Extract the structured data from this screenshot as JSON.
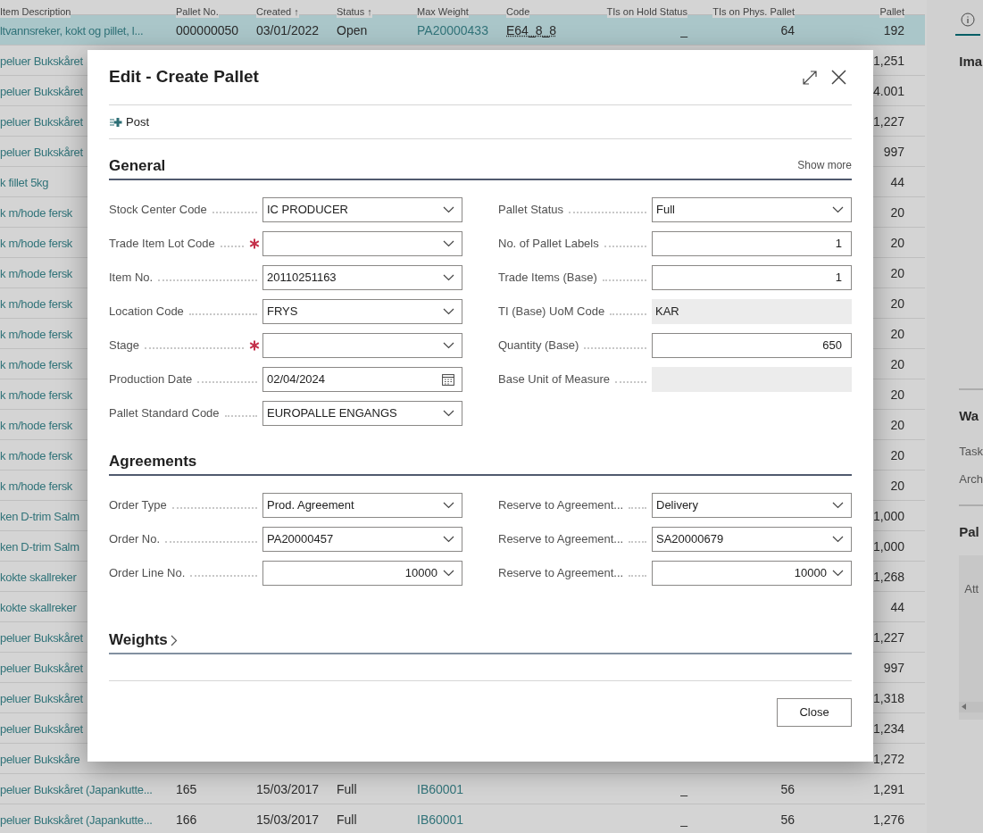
{
  "table": {
    "columns": [
      "Item Description",
      "Pallet No.",
      "Created ↑",
      "Status ↑",
      "Max Weight",
      "Code",
      "TIs on Hold Status",
      "TIs on Phys. Pallet",
      "Pallet"
    ],
    "rows": [
      {
        "selected": true,
        "cells": [
          "ltvannsreker, kokt og pillet, l...",
          "000000050",
          "03/01/2022",
          "Open",
          "PA20000433",
          "E64_8_8",
          "_",
          "64",
          "192"
        ]
      },
      {
        "selected": false,
        "cells": [
          "peluer Bukskåret",
          "1,251"
        ]
      },
      {
        "selected": false,
        "cells": [
          "peluer Bukskåret",
          "4.001"
        ]
      },
      {
        "selected": false,
        "cells": [
          "peluer Bukskåret",
          "1,227"
        ]
      },
      {
        "selected": false,
        "cells": [
          "peluer Bukskåret",
          "997"
        ]
      },
      {
        "selected": false,
        "cells": [
          "k fillet 5kg",
          "44"
        ]
      },
      {
        "selected": false,
        "cells": [
          "k m/hode fersk",
          "20"
        ]
      },
      {
        "selected": false,
        "cells": [
          "k m/hode fersk",
          "20"
        ]
      },
      {
        "selected": false,
        "cells": [
          "k m/hode fersk",
          "20"
        ]
      },
      {
        "selected": false,
        "cells": [
          "k m/hode fersk",
          "20"
        ]
      },
      {
        "selected": false,
        "cells": [
          "k m/hode fersk",
          "20"
        ]
      },
      {
        "selected": false,
        "cells": [
          "k m/hode fersk",
          "20"
        ]
      },
      {
        "selected": false,
        "cells": [
          "k m/hode fersk",
          "20"
        ]
      },
      {
        "selected": false,
        "cells": [
          "k m/hode fersk",
          "20"
        ]
      },
      {
        "selected": false,
        "cells": [
          "k m/hode fersk",
          "20"
        ]
      },
      {
        "selected": false,
        "cells": [
          "k m/hode fersk",
          "20"
        ]
      },
      {
        "selected": false,
        "cells": [
          "ken D-trim Salm",
          "1,000"
        ]
      },
      {
        "selected": false,
        "cells": [
          "ken D-trim Salm",
          "1,000"
        ]
      },
      {
        "selected": false,
        "cells": [
          "kokte skallreker",
          "1,268"
        ]
      },
      {
        "selected": false,
        "cells": [
          "kokte skallreker",
          "44"
        ]
      },
      {
        "selected": false,
        "cells": [
          "peluer Bukskåret",
          "1,227"
        ]
      },
      {
        "selected": false,
        "cells": [
          "peluer Bukskåret",
          "997"
        ]
      },
      {
        "selected": false,
        "cells": [
          "peluer Bukskåret",
          "1,318"
        ]
      },
      {
        "selected": false,
        "cells": [
          "peluer Bukskåret",
          "1,234"
        ]
      },
      {
        "selected": false,
        "cells": [
          "peluer Bukskåre",
          "1,272"
        ]
      },
      {
        "selected": false,
        "cells": [
          "peluer Bukskåret (Japankutte...",
          "165",
          "15/03/2017",
          "Full",
          "IB60001",
          "",
          "_",
          "56",
          "1,291"
        ]
      },
      {
        "selected": false,
        "cells": [
          "peluer Bukskåret (Japankutte...",
          "166",
          "15/03/2017",
          "Full",
          "IB60001",
          "",
          "_",
          "56",
          "1,276"
        ]
      }
    ]
  },
  "factbox": {
    "sections": [
      {
        "title": "Ima"
      },
      {
        "title": "Wa",
        "items": [
          "Task",
          "Arch"
        ]
      },
      {
        "title": "Pal",
        "items": [
          "Att"
        ]
      }
    ]
  },
  "dialog": {
    "title": "Edit - Create Pallet",
    "action": "Post",
    "sections": [
      {
        "title": "General",
        "collapsed": false,
        "show_more": "Show more",
        "left": [
          {
            "label": "Stock Center Code",
            "kind": "dropdown",
            "value": "IC PRODUCER",
            "required": false
          },
          {
            "label": "Trade Item Lot Code",
            "kind": "dropdown",
            "required": true
          },
          {
            "label": "Item No.",
            "kind": "dropdown",
            "value": "20110251163",
            "required": false
          },
          {
            "label": "Location Code",
            "kind": "dropdown",
            "value": "FRYS",
            "required": false
          },
          {
            "label": "Stage",
            "kind": "dropdown",
            "required": true
          },
          {
            "label": "Production Date",
            "kind": "date",
            "value": "02/04/2024",
            "required": false
          },
          {
            "label": "Pallet Standard Code",
            "kind": "dropdown",
            "value": "EUROPALLE ENGANGS",
            "required": false
          }
        ],
        "right": [
          {
            "label": "Pallet Status",
            "kind": "dropdown",
            "value": "Full",
            "required": false
          },
          {
            "label": "No. of Pallet Labels",
            "kind": "number",
            "value": "1",
            "required": false
          },
          {
            "label": "Trade Items (Base)",
            "kind": "number",
            "value": "1",
            "required": false
          },
          {
            "label": "TI (Base) UoM Code",
            "kind": "readonly",
            "value": "KAR",
            "required": false
          },
          {
            "label": "Quantity (Base)",
            "kind": "number",
            "value": "650",
            "required": false
          },
          {
            "label": "Base Unit of Measure",
            "kind": "readonly",
            "required": false
          }
        ]
      },
      {
        "title": "Agreements",
        "collapsed": false,
        "left": [
          {
            "label": "Order Type",
            "kind": "dropdown",
            "value": "Prod. Agreement",
            "required": false
          },
          {
            "label": "Order No.",
            "kind": "dropdown",
            "value": "PA20000457",
            "required": false
          },
          {
            "label": "Order Line No.",
            "kind": "number-dropdown",
            "value": "10000",
            "required": false
          }
        ],
        "right": [
          {
            "label": "Reserve to Agreement...",
            "kind": "dropdown",
            "value": "Delivery",
            "required": false
          },
          {
            "label": "Reserve to Agreement...",
            "kind": "dropdown",
            "value": "SA20000679",
            "required": false
          },
          {
            "label": "Reserve to Agreement...",
            "kind": "number-dropdown",
            "value": "10000",
            "required": false
          }
        ]
      },
      {
        "title": "Weights",
        "collapsed": true
      }
    ],
    "close": "Close"
  }
}
